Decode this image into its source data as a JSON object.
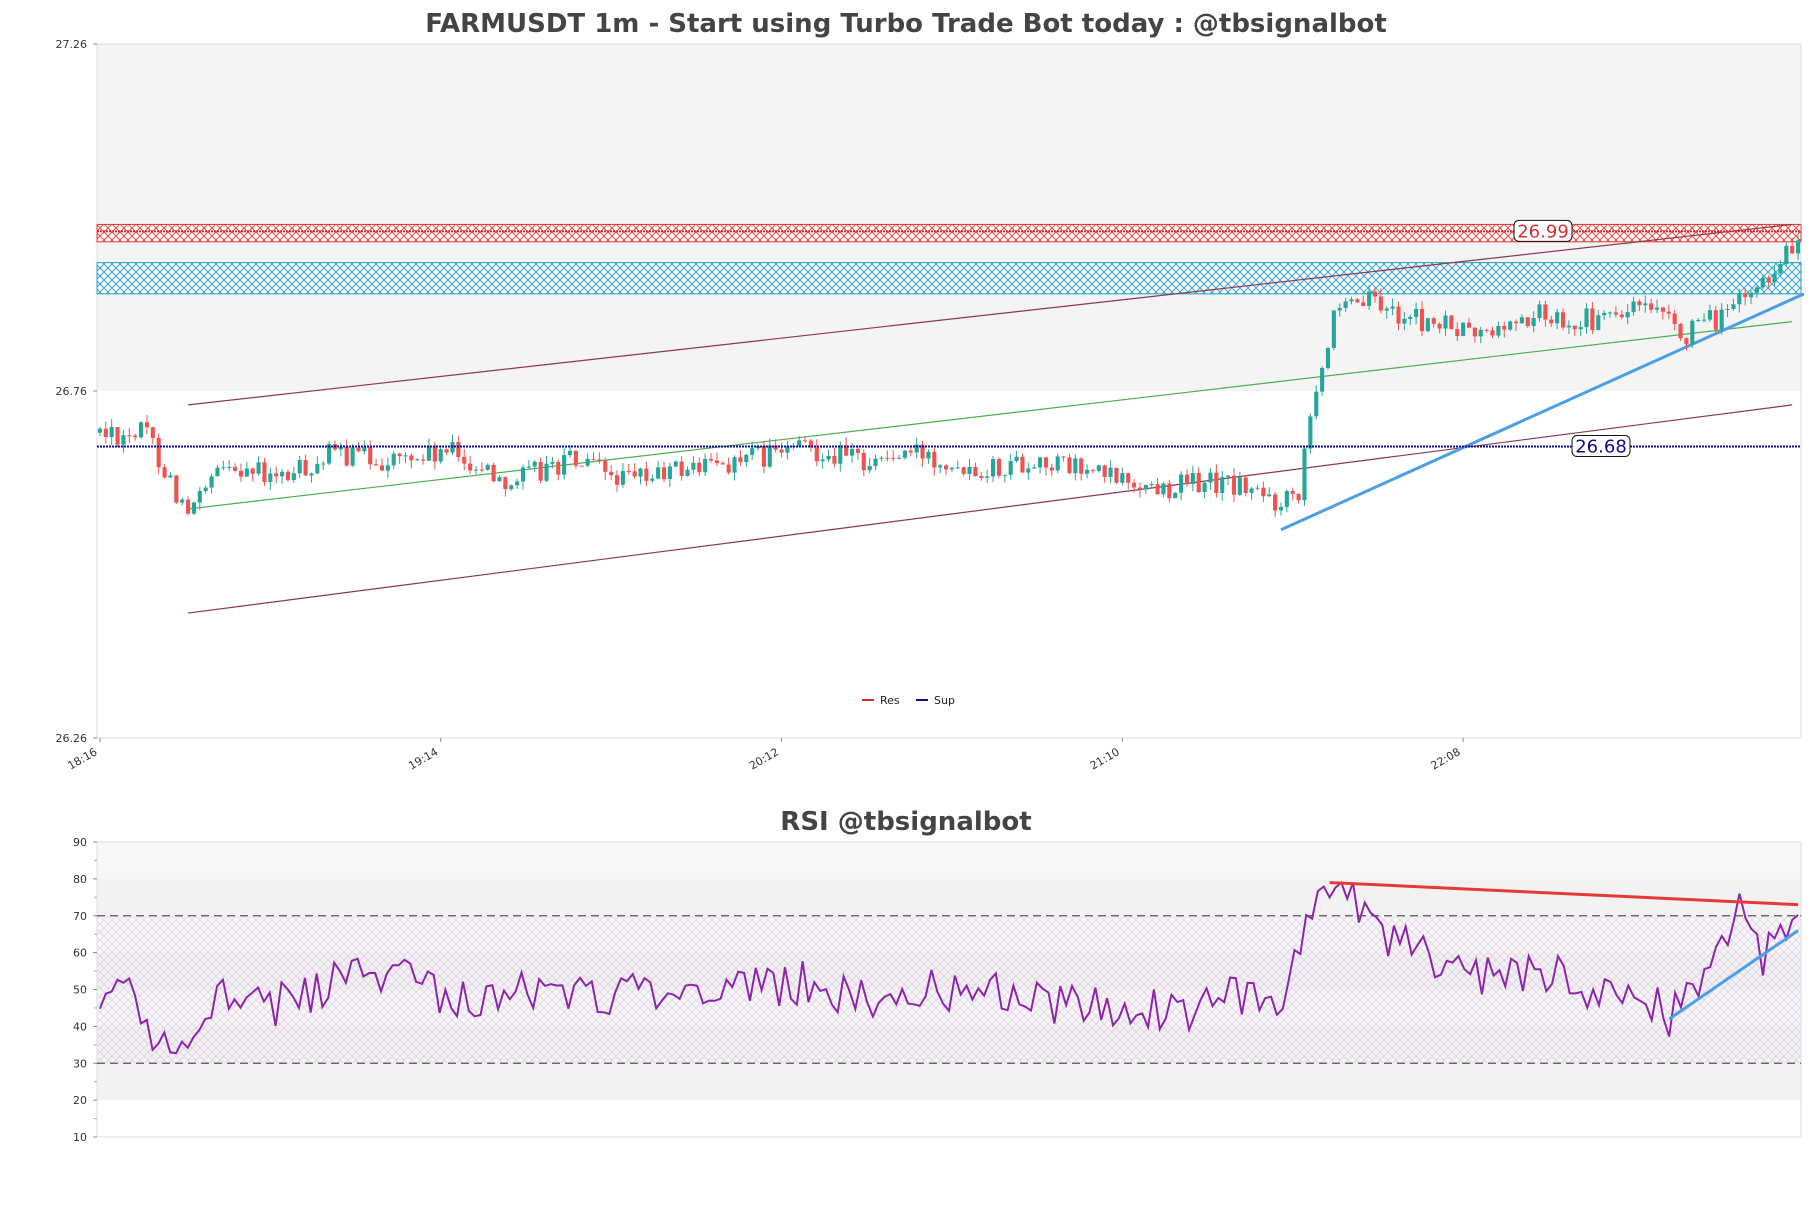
{
  "colors": {
    "up": "#26a69a",
    "down": "#ef5350",
    "res": "#d32f2f",
    "sup": "#0d0d8c",
    "res_zone": "#e53935",
    "sup_zone": "#1e9fc6",
    "trend_upper": "#8a3a4a",
    "trend_mid": "#4caf50",
    "trend_rise": "#4a9fe8",
    "rsi_line": "#8e24aa",
    "rsi_res": "#e53935",
    "rsi_sup": "#4a9fe8"
  },
  "chart_data": [
    {
      "type": "candlestick",
      "title": "FARMUSDT 1m - Start using Turbo Trade Bot today : @tbsignalbot",
      "ylim": [
        26.26,
        27.26
      ],
      "yticks": [
        "27.26",
        "26.76",
        "26.26"
      ],
      "xticks": [
        "18:16",
        "19:14",
        "20:12",
        "21:10",
        "22:08"
      ],
      "candle_count": 290,
      "legend": {
        "position": "bottom-center",
        "entries": [
          "Res",
          "Sup"
        ]
      },
      "levels": [
        {
          "name": "Res",
          "label": "26.99",
          "value": 26.99,
          "zone": [
            26.975,
            27.0
          ]
        },
        {
          "name": "Sup",
          "label": "26.68",
          "value": 26.68,
          "zone": [
            26.9,
            26.945
          ]
        }
      ],
      "segments": [
        {
          "name": "channel-upper",
          "from": [
            15,
            26.74
          ],
          "to": [
            288,
            27.0
          ]
        },
        {
          "name": "channel-lower",
          "from": [
            15,
            26.44
          ],
          "to": [
            288,
            26.74
          ]
        },
        {
          "name": "mid-trend",
          "from": [
            15,
            26.59
          ],
          "to": [
            288,
            26.86
          ]
        },
        {
          "name": "rising-trend",
          "from": [
            201,
            26.56
          ],
          "to": [
            290,
            26.9
          ]
        }
      ],
      "path": [
        [
          0,
          26.7
        ],
        [
          8,
          26.7
        ],
        [
          15,
          26.58
        ],
        [
          22,
          26.66
        ],
        [
          30,
          26.63
        ],
        [
          40,
          26.67
        ],
        [
          50,
          26.66
        ],
        [
          60,
          26.67
        ],
        [
          70,
          26.63
        ],
        [
          80,
          26.66
        ],
        [
          90,
          26.63
        ],
        [
          100,
          26.65
        ],
        [
          110,
          26.66
        ],
        [
          120,
          26.68
        ],
        [
          130,
          26.66
        ],
        [
          140,
          26.67
        ],
        [
          150,
          26.65
        ],
        [
          160,
          26.66
        ],
        [
          170,
          26.64
        ],
        [
          180,
          26.62
        ],
        [
          188,
          26.63
        ],
        [
          195,
          26.62
        ],
        [
          200,
          26.6
        ],
        [
          204,
          26.62
        ],
        [
          206,
          26.74
        ],
        [
          210,
          26.86
        ],
        [
          215,
          26.89
        ],
        [
          225,
          26.86
        ],
        [
          235,
          26.84
        ],
        [
          245,
          26.87
        ],
        [
          255,
          26.86
        ],
        [
          262,
          26.88
        ],
        [
          270,
          26.84
        ],
        [
          280,
          26.89
        ],
        [
          286,
          26.95
        ],
        [
          290,
          26.99
        ]
      ]
    },
    {
      "type": "line",
      "title": "RSI @tbsignalbot",
      "ylim": [
        10,
        90
      ],
      "yticks": [
        10,
        20,
        30,
        40,
        50,
        60,
        70,
        80,
        90
      ],
      "levels": [
        70,
        30
      ],
      "segments": [
        {
          "name": "rsi-res-trend",
          "from": [
            210,
            79
          ],
          "to": [
            290,
            73
          ]
        },
        {
          "name": "rsi-sup-trend",
          "from": [
            268,
            42
          ],
          "to": [
            290,
            66
          ]
        }
      ],
      "path": [
        [
          0,
          42
        ],
        [
          3,
          51
        ],
        [
          5,
          48
        ],
        [
          8,
          38
        ],
        [
          12,
          36
        ],
        [
          15,
          34
        ],
        [
          18,
          48
        ],
        [
          25,
          50
        ],
        [
          30,
          46
        ],
        [
          40,
          52
        ],
        [
          50,
          55
        ],
        [
          60,
          48
        ],
        [
          70,
          49
        ],
        [
          80,
          50
        ],
        [
          90,
          48
        ],
        [
          100,
          52
        ],
        [
          110,
          50
        ],
        [
          120,
          52
        ],
        [
          130,
          48
        ],
        [
          140,
          50
        ],
        [
          150,
          49
        ],
        [
          160,
          47
        ],
        [
          170,
          46
        ],
        [
          180,
          45
        ],
        [
          185,
          42
        ],
        [
          190,
          50
        ],
        [
          195,
          48
        ],
        [
          200,
          45
        ],
        [
          203,
          50
        ],
        [
          206,
          68
        ],
        [
          210,
          75
        ],
        [
          213,
          78
        ],
        [
          216,
          72
        ],
        [
          220,
          63
        ],
        [
          225,
          60
        ],
        [
          230,
          58
        ],
        [
          235,
          54
        ],
        [
          240,
          56
        ],
        [
          245,
          55
        ],
        [
          250,
          54
        ],
        [
          255,
          50
        ],
        [
          260,
          49
        ],
        [
          265,
          46
        ],
        [
          268,
          43
        ],
        [
          272,
          52
        ],
        [
          276,
          60
        ],
        [
          280,
          73
        ],
        [
          284,
          58
        ],
        [
          287,
          71
        ],
        [
          290,
          66
        ]
      ]
    }
  ]
}
